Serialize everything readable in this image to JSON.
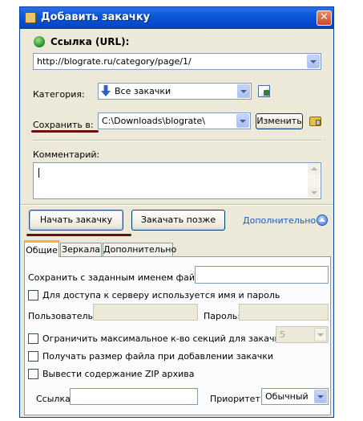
{
  "window": {
    "title": "Добавить закачку",
    "close": "✕"
  },
  "url": {
    "label": "Ссылка (URL):",
    "value": "http://blograte.ru/category/page/1/"
  },
  "category": {
    "label": "Категория:",
    "value": "Все закачки"
  },
  "save": {
    "label": "Сохранить в:",
    "path": "C:\\Downloads\\blograte\\",
    "change_button": "Изменить"
  },
  "comment": {
    "label": "Комментарий:"
  },
  "actions": {
    "start": "Начать закачку",
    "later": "Закачать позже",
    "more": "Дополнительно"
  },
  "tabs": [
    "Общие",
    "Зеркала",
    "Дополнительно"
  ],
  "general": {
    "save_as_label": "Сохранить с заданным именем файла:",
    "auth_checkbox": "Для доступа к серверу используется имя и пароль",
    "user_label": "Пользователь:",
    "password_label": "Пароль:",
    "limit_sections": "Ограничить максимальное к-во секций для закачки",
    "sections_value": "5",
    "get_size": "Получать размер файла при добавлении закачки",
    "zip_content": "Вывести содержание ZIP архива",
    "referer_label": "Ссылка:",
    "priority_label": "Приоритет:",
    "priority_value": "Обычный"
  }
}
